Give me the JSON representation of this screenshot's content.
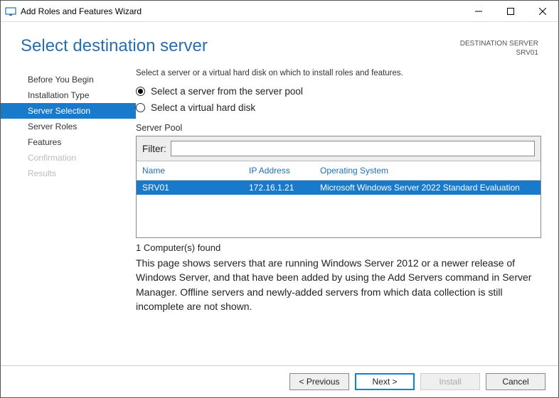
{
  "window": {
    "title": "Add Roles and Features Wizard"
  },
  "header": {
    "page_title": "Select destination server",
    "dest_label": "DESTINATION SERVER",
    "dest_value": "SRV01"
  },
  "sidebar": {
    "items": [
      {
        "label": "Before You Begin",
        "state": "normal"
      },
      {
        "label": "Installation Type",
        "state": "normal"
      },
      {
        "label": "Server Selection",
        "state": "active"
      },
      {
        "label": "Server Roles",
        "state": "normal"
      },
      {
        "label": "Features",
        "state": "normal"
      },
      {
        "label": "Confirmation",
        "state": "disabled"
      },
      {
        "label": "Results",
        "state": "disabled"
      }
    ]
  },
  "main": {
    "instruction": "Select a server or a virtual hard disk on which to install roles and features.",
    "radio_pool": "Select a server from the server pool",
    "radio_vhd": "Select a virtual hard disk",
    "selected_radio": "pool",
    "pool_label": "Server Pool",
    "filter_label": "Filter:",
    "filter_value": "",
    "columns": {
      "name": "Name",
      "ip": "IP Address",
      "os": "Operating System"
    },
    "rows": [
      {
        "name": "SRV01",
        "ip": "172.16.1.21",
        "os": "Microsoft Windows Server 2022 Standard Evaluation",
        "selected": true
      }
    ],
    "found_text": "1 Computer(s) found",
    "explain_text": "This page shows servers that are running Windows Server 2012 or a newer release of Windows Server, and that have been added by using the Add Servers command in Server Manager. Offline servers and newly-added servers from which data collection is still incomplete are not shown."
  },
  "footer": {
    "previous": "< Previous",
    "next": "Next >",
    "install": "Install",
    "cancel": "Cancel"
  }
}
